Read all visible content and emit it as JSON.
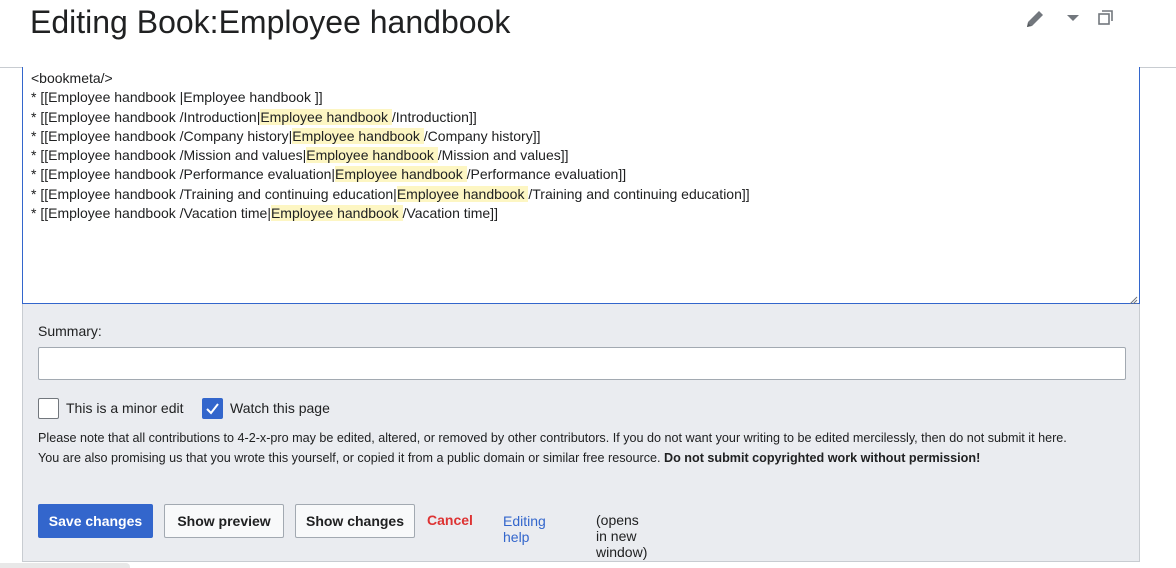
{
  "page": {
    "title": "Editing Book:Employee handbook"
  },
  "toolbar_icons": [
    "pencil-icon",
    "chevron-down-icon",
    "restore-window-icon"
  ],
  "editor": {
    "lines": [
      [
        {
          "t": "<bookmeta/>",
          "hl": false
        }
      ],
      [
        {
          "t": "* [[Employee handbook |Employee handbook ]]",
          "hl": false
        }
      ],
      [
        {
          "t": "* [[Employee handbook /Introduction|",
          "hl": false
        },
        {
          "t": "Employee handbook ",
          "hl": true
        },
        {
          "t": "/Introduction]]",
          "hl": false
        }
      ],
      [
        {
          "t": "* [[Employee handbook /Company history|",
          "hl": false
        },
        {
          "t": "Employee handbook ",
          "hl": true
        },
        {
          "t": "/Company history]]",
          "hl": false
        }
      ],
      [
        {
          "t": "* [[Employee handbook /Mission and values|",
          "hl": false
        },
        {
          "t": "Employee handbook ",
          "hl": true
        },
        {
          "t": "/Mission and values]]",
          "hl": false
        }
      ],
      [
        {
          "t": "* [[Employee handbook /Performance evaluation|",
          "hl": false
        },
        {
          "t": "Employee handbook ",
          "hl": true
        },
        {
          "t": "/Performance evaluation]]",
          "hl": false
        }
      ],
      [
        {
          "t": "* [[Employee handbook /Training and continuing education|",
          "hl": false
        },
        {
          "t": "Employee handbook ",
          "hl": true
        },
        {
          "t": "/Training and continuing education]]",
          "hl": false
        }
      ],
      [
        {
          "t": "* [[Employee handbook /Vacation time|",
          "hl": false
        },
        {
          "t": "Employee handbook ",
          "hl": true
        },
        {
          "t": "/Vacation time]]",
          "hl": false
        }
      ]
    ]
  },
  "summary": {
    "label": "Summary:",
    "value": "",
    "placeholder": ""
  },
  "options": {
    "minor_edit_label": "This is a minor edit",
    "minor_edit_checked": false,
    "watch_label": "Watch this page",
    "watch_checked": true
  },
  "notice": {
    "line1": "Please note that all contributions to 4-2-x-pro may be edited, altered, or removed by other contributors. If you do not want your writing to be edited mercilessly, then do not submit it here.",
    "line2": "You are also promising us that you wrote this yourself, or copied it from a public domain or similar free resource. ",
    "line2_bold": "Do not submit copyrighted work without permission!"
  },
  "buttons": {
    "save": "Save changes",
    "preview": "Show preview",
    "changes": "Show changes",
    "cancel": "Cancel",
    "help": "Editing help",
    "help_note": "(opens in new window)"
  },
  "colors": {
    "accent": "#3366cc",
    "cancel": "#dd3333",
    "highlight": "#fdf6c3",
    "panel": "#eaecf0"
  }
}
